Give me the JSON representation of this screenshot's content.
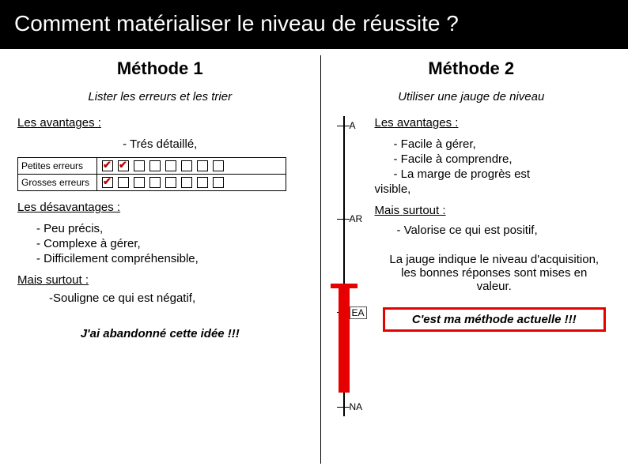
{
  "title": "Comment matérialiser le niveau de réussite ?",
  "left": {
    "method_title": "Méthode 1",
    "subtitle": "Lister les erreurs et les trier",
    "advantages_head": "Les avantages :",
    "adv1": "- Trés détaillé,",
    "row1_label": "Petites erreurs",
    "row2_label": "Grosses erreurs",
    "disadvantages_head": "Les désavantages :",
    "dis1": "- Peu précis,",
    "dis2": "- Complexe à gérer,",
    "dis3": "- Difficilement compréhensible,",
    "mais": "Mais surtout :",
    "neg": "-Souligne ce qui est négatif,",
    "abandon": "J'ai abandonné cette idée !!!"
  },
  "right": {
    "method_title": "Méthode 2",
    "subtitle": "Utiliser une jauge de niveau",
    "advantages_head": "Les avantages :",
    "adv1": "- Facile à gérer,",
    "adv2": "- Facile à comprendre,",
    "adv3": "- La marge de progrès est",
    "visible": "visible,",
    "mais": "Mais surtout :",
    "valorise": "- Valorise ce qui est positif,",
    "gauge_note": "La jauge indique le niveau d'acquisition, les bonnes réponses sont mises en valeur.",
    "current": "C'est ma méthode actuelle !!!",
    "ticks": {
      "t0": "A",
      "t1": "AR",
      "t2": "EA",
      "t3": "NA"
    }
  }
}
